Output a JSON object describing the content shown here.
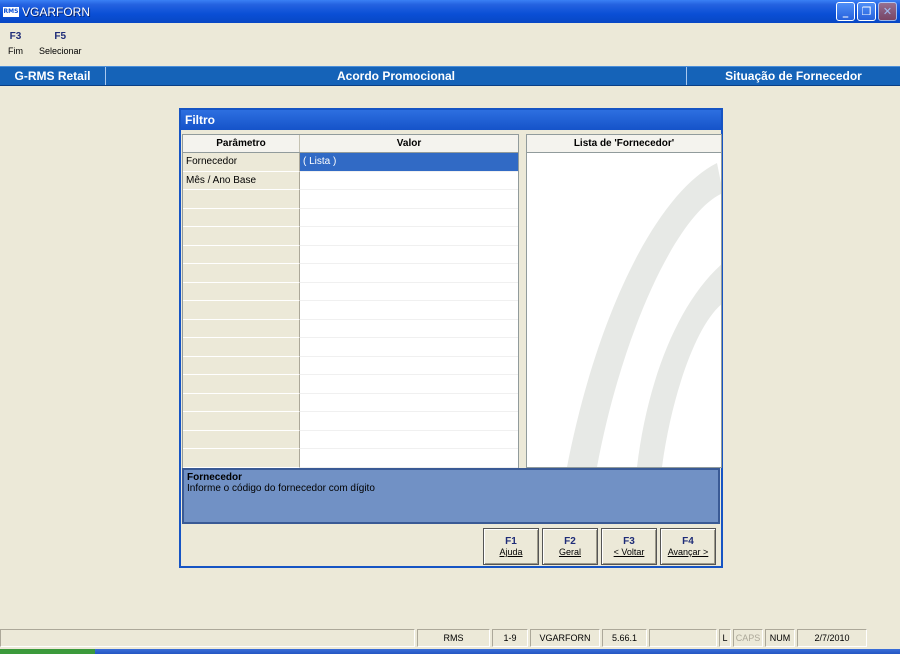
{
  "window": {
    "title": "VGARFORN",
    "icon_text": "RMS"
  },
  "toolbar": [
    {
      "key": "F3",
      "label": "Fim"
    },
    {
      "key": "F5",
      "label": "Selecionar"
    }
  ],
  "band": {
    "left": "G-RMS Retail",
    "center": "Acordo Promocional",
    "right": "Situação de Fornecedor"
  },
  "dialog": {
    "title": "Filtro",
    "grid_headers": {
      "param": "Parâmetro",
      "value": "Valor"
    },
    "rows": [
      {
        "param": "Fornecedor",
        "value": "( Lista )"
      },
      {
        "param": "Mês / Ano Base",
        "value": ""
      }
    ],
    "list_title": "Lista de 'Fornecedor'",
    "help_title": "Fornecedor",
    "help_text": "Informe o código do fornecedor com dígito",
    "buttons": [
      {
        "key": "F1",
        "label": "Ajuda"
      },
      {
        "key": "F2",
        "label": "Geral"
      },
      {
        "key": "F3",
        "label": "< Voltar"
      },
      {
        "key": "F4",
        "label": "Avançar >"
      }
    ]
  },
  "status": {
    "s1": "",
    "s2": "RMS",
    "s3": "1-9",
    "s4": "VGARFORN",
    "s5": "5.66.1",
    "s6": "",
    "l": "L",
    "caps": "CAPS",
    "num": "NUM",
    "date": "2/7/2010"
  },
  "colors": {
    "band": "#1563b8",
    "selection": "#316ac5",
    "help_bg": "#7191c5"
  }
}
